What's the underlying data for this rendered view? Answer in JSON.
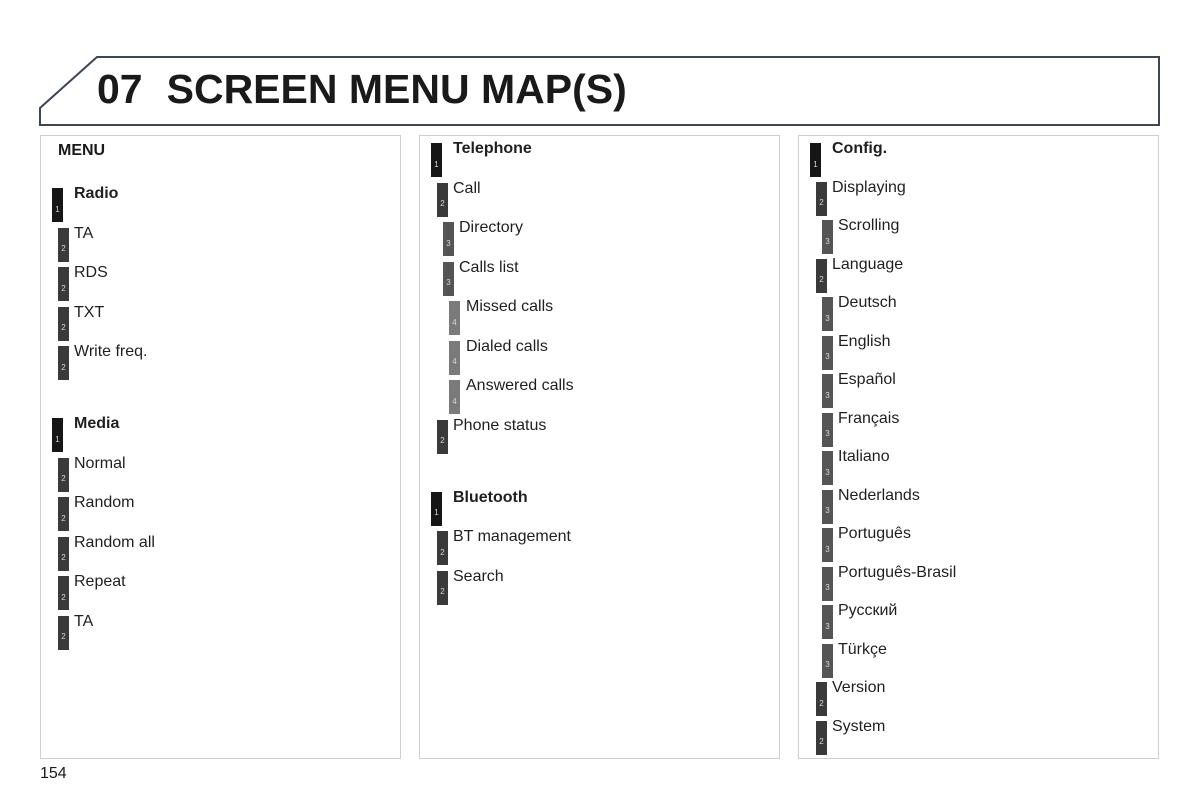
{
  "header": {
    "chapter": "07",
    "title": "SCREEN MENU MAP(S)"
  },
  "page_number": "154",
  "columns": [
    {
      "heading": "MENU",
      "groups": [
        {
          "items": [
            {
              "level": 1,
              "label": "Radio"
            },
            {
              "level": 2,
              "label": "TA"
            },
            {
              "level": 2,
              "label": "RDS"
            },
            {
              "level": 2,
              "label": "TXT"
            },
            {
              "level": 2,
              "label": "Write freq."
            }
          ]
        },
        {
          "items": [
            {
              "level": 1,
              "label": "Media"
            },
            {
              "level": 2,
              "label": "Normal"
            },
            {
              "level": 2,
              "label": "Random"
            },
            {
              "level": 2,
              "label": "Random all"
            },
            {
              "level": 2,
              "label": "Repeat"
            },
            {
              "level": 2,
              "label": "TA"
            }
          ]
        }
      ]
    },
    {
      "heading": "",
      "groups": [
        {
          "items": [
            {
              "level": 1,
              "label": "Telephone"
            },
            {
              "level": 2,
              "label": "Call"
            },
            {
              "level": 3,
              "label": "Directory"
            },
            {
              "level": 3,
              "label": "Calls list"
            },
            {
              "level": 4,
              "label": "Missed calls"
            },
            {
              "level": 4,
              "label": "Dialed calls"
            },
            {
              "level": 4,
              "label": "Answered calls"
            },
            {
              "level": 2,
              "label": "Phone status"
            }
          ]
        },
        {
          "items": [
            {
              "level": 1,
              "label": "Bluetooth"
            },
            {
              "level": 2,
              "label": "BT management"
            },
            {
              "level": 2,
              "label": "Search"
            }
          ]
        }
      ]
    },
    {
      "heading": "",
      "groups": [
        {
          "items": [
            {
              "level": 1,
              "label": "Config."
            },
            {
              "level": 2,
              "label": "Displaying"
            },
            {
              "level": 3,
              "label": "Scrolling"
            },
            {
              "level": 2,
              "label": "Language"
            },
            {
              "level": 3,
              "label": "Deutsch"
            },
            {
              "level": 3,
              "label": "English"
            },
            {
              "level": 3,
              "label": "Español"
            },
            {
              "level": 3,
              "label": "Français"
            },
            {
              "level": 3,
              "label": "Italiano"
            },
            {
              "level": 3,
              "label": "Nederlands"
            },
            {
              "level": 3,
              "label": "Português"
            },
            {
              "level": 3,
              "label": "Português-Brasil"
            },
            {
              "level": 3,
              "label": "Русский"
            },
            {
              "level": 3,
              "label": "Türkçe"
            },
            {
              "level": 2,
              "label": "Version"
            },
            {
              "level": 2,
              "label": "System"
            }
          ]
        }
      ]
    }
  ]
}
